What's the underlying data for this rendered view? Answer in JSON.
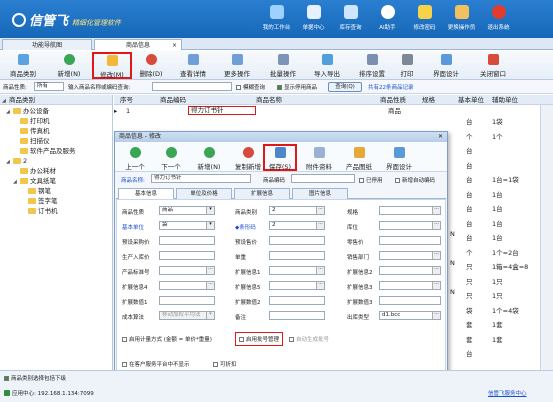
{
  "app": {
    "brand": "信管飞",
    "brand_sub": "精细化管理软件"
  },
  "topnav": [
    {
      "label": "我的工作台",
      "icon": "desktop-icon"
    },
    {
      "label": "单据中心",
      "icon": "document-center-icon"
    },
    {
      "label": "库存查询",
      "icon": "inventory-icon"
    },
    {
      "label": "AI助手",
      "icon": "ai-assistant-icon"
    },
    {
      "label": "修改密码",
      "icon": "lock-icon"
    },
    {
      "label": "更换操作员",
      "icon": "operator-icon"
    },
    {
      "label": "退出系统",
      "icon": "exit-icon"
    }
  ],
  "tabs": [
    {
      "label": "功能导航图"
    },
    {
      "label": "商品信息",
      "close": "×"
    }
  ],
  "toolbar": [
    {
      "label": "商品类别",
      "icon": "category-icon"
    },
    {
      "label": "新增(N)",
      "icon": "add-icon"
    },
    {
      "label": "修改(M)",
      "icon": "edit-icon"
    },
    {
      "label": "删除(D)",
      "icon": "delete-icon"
    },
    {
      "label": "查看详情",
      "icon": "view-icon"
    },
    {
      "label": "更多操作",
      "icon": "more-icon"
    },
    {
      "label": "批量操作",
      "icon": "batch-icon"
    },
    {
      "label": "导入导出",
      "icon": "import-export-icon"
    },
    {
      "label": "排序设置",
      "icon": "sort-icon"
    },
    {
      "label": "打印",
      "icon": "print-icon"
    },
    {
      "label": "界面设计",
      "icon": "design-icon"
    },
    {
      "label": "关闭窗口",
      "icon": "close-window-icon"
    }
  ],
  "filter": {
    "status_label": "商品性质:",
    "status_value": "所有",
    "search_label": "输入商品名称或编码查询:",
    "fuzzy_label": "模糊查询",
    "show_disabled_label": "显示停用商品",
    "query_label": "查询(Q)",
    "count_text": "共有22条商品记录"
  },
  "tree": {
    "header": "商品类别",
    "nodes": [
      {
        "label": "办公设备",
        "level": 1,
        "toggle": "◢"
      },
      {
        "label": "打印机",
        "level": 2
      },
      {
        "label": "传真机",
        "level": 2
      },
      {
        "label": "扫描仪",
        "level": 2
      },
      {
        "label": "软件产品及服务",
        "level": 2
      },
      {
        "label": "2",
        "level": 1,
        "toggle": "◢"
      },
      {
        "label": "办公耗材",
        "level": 2
      },
      {
        "label": "文具纸笔",
        "level": 2,
        "toggle": "◢"
      },
      {
        "label": "钢笔",
        "level": 3
      },
      {
        "label": "签字笔",
        "level": 3
      },
      {
        "label": "订书机",
        "level": 3
      }
    ]
  },
  "grid": {
    "headers": [
      "序号",
      "商品编码",
      "商品名称",
      "商品性质",
      "规格",
      "基本单位",
      "辅助单位"
    ],
    "first_row": {
      "index": "1",
      "name": "得力订书针",
      "type": "商品"
    },
    "units": [
      "台",
      "个",
      "台",
      "台",
      "台",
      "台",
      "台",
      "台",
      "台",
      "个",
      "只",
      "只",
      "只",
      "袋",
      "套",
      "套",
      "台"
    ],
    "aux": [
      "1袋",
      "1个",
      "",
      "",
      "1台=1袋",
      "1台",
      "1台",
      "1台",
      "1台",
      "1个=2台",
      "1箱=4盒=8",
      "1只",
      "1只",
      "1个=4袋",
      "1套",
      "1套",
      ""
    ],
    "side_marks": [
      "N",
      "N",
      "N"
    ]
  },
  "dialog": {
    "title": "商品信息 - 修改",
    "toolbar": [
      {
        "label": "上一个",
        "icon": "prev-icon"
      },
      {
        "label": "下一个",
        "icon": "next-icon"
      },
      {
        "label": "新增(N)",
        "icon": "add-icon"
      },
      {
        "label": "复制新增",
        "icon": "copy-add-icon"
      },
      {
        "label": "保存(S)",
        "icon": "save-icon"
      },
      {
        "label": "附件资料",
        "icon": "attachment-icon"
      },
      {
        "label": "产品图纸",
        "icon": "drawing-icon"
      },
      {
        "label": "界面设计",
        "icon": "design-icon"
      }
    ],
    "name_label": "商品名称:",
    "name_value": "得力订书针",
    "code_label": "商品编码",
    "disabled_label": "已停用",
    "auto_code_label": "新增自动编码",
    "tabs": [
      "基本信息",
      "单位及价格",
      "扩展信息",
      "图片信息"
    ],
    "fields": {
      "prop_label": "商品性质",
      "prop_value": "商品",
      "cat_label": "商品类别",
      "cat_value": "2",
      "spec_label": "规格",
      "unit_label": "基本单位",
      "unit_value": "袋",
      "barcode_label": "条形码",
      "barcode_value": "2",
      "pos_label": "库位",
      "purchase_label": "预设采购价",
      "sale_label": "预设售价",
      "ref_label": "零售价",
      "prod_label": "生产入库价",
      "weight_label": "单重",
      "dept_label": "销售部门",
      "std_label": "产品标准号",
      "ext1_label": "扩展信息1",
      "ext2_label": "扩展信息2",
      "ext3_label": "扩展信息3",
      "ext4_label": "扩展信息4",
      "ext5_label": "扩展信息5",
      "ext6_label": "扩展信息6",
      "extn1_label": "扩展数值1",
      "extn2_label": "扩展数值2",
      "extn3_label": "扩展数值3",
      "cost_label": "成本算法",
      "cost_value": "移动加权平均法",
      "note_label": "备注",
      "model_label": "出库类型",
      "model_value": "d1.bcc",
      "calc_label": "启用计量方式 (金额 = 单价*重量)",
      "batch_label": "启用批号管理",
      "auto_batch_label": "自动生成批号",
      "client_label": "在客户服务平台中不显示",
      "discount_label": "可折扣"
    }
  },
  "status": {
    "left": "商品类别选择包括下级",
    "server": "应用中心: 192.168.1.134:7099",
    "right": "信管飞服务中心"
  }
}
